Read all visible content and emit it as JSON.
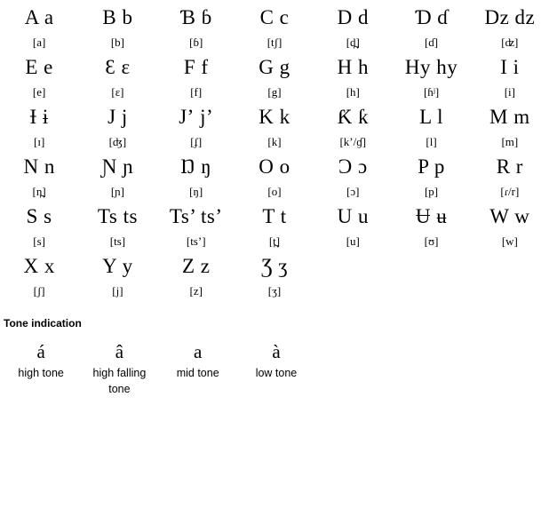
{
  "page": {
    "background_color": "#ffffff",
    "text_color": "#000000"
  },
  "alphabet": {
    "columns": 7,
    "rows": [
      {
        "cells": [
          {
            "letters": "A a",
            "ipa": "[a]"
          },
          {
            "letters": "B b",
            "ipa": "[b]"
          },
          {
            "letters": "Ɓ ɓ",
            "ipa": "[ɓ]"
          },
          {
            "letters": "C c",
            "ipa": "[tʃ]"
          },
          {
            "letters": "D d",
            "ipa": "[d̪]"
          },
          {
            "letters": "Ɗ ɗ",
            "ipa": "[ɗ]"
          },
          {
            "letters": "Dz dz",
            "ipa": "[ʣ]"
          }
        ]
      },
      {
        "cells": [
          {
            "letters": "E e",
            "ipa": "[e]"
          },
          {
            "letters": "Ɛ ɛ",
            "ipa": "[ɛ]"
          },
          {
            "letters": "F f",
            "ipa": "[f]"
          },
          {
            "letters": "G g",
            "ipa": "[g]"
          },
          {
            "letters": "H h",
            "ipa": "[h]"
          },
          {
            "letters": "Hy hy",
            "ipa": "[ɦʲ]"
          },
          {
            "letters": "I i",
            "ipa": "[i]"
          }
        ]
      },
      {
        "cells": [
          {
            "letters": "Ɨ ɨ",
            "ipa": "[ɪ]"
          },
          {
            "letters": "J j",
            "ipa": "[ʤ]"
          },
          {
            "letters": "Jʼ jʼ",
            "ipa": "[ʄ]"
          },
          {
            "letters": "K k",
            "ipa": "[k]"
          },
          {
            "letters": "Ƙ ƙ",
            "ipa": "[k’/ɠ]"
          },
          {
            "letters": "L l",
            "ipa": "[l]"
          },
          {
            "letters": "M m",
            "ipa": "[m]"
          }
        ]
      },
      {
        "cells": [
          {
            "letters": "N n",
            "ipa": "[n̪]"
          },
          {
            "letters": "Ɲ ɲ",
            "ipa": "[ɲ]"
          },
          {
            "letters": "Ŋ ŋ",
            "ipa": "[ŋ]"
          },
          {
            "letters": "O o",
            "ipa": "[o]"
          },
          {
            "letters": "Ɔ ɔ",
            "ipa": "[ɔ]"
          },
          {
            "letters": "P p",
            "ipa": "[p]"
          },
          {
            "letters": "R r",
            "ipa": "[ɾ/r]"
          }
        ]
      },
      {
        "cells": [
          {
            "letters": "S s",
            "ipa": "[s]"
          },
          {
            "letters": "Ts ts",
            "ipa": "[ts]"
          },
          {
            "letters": "Ts’ ts’",
            "ipa": "[ts’]"
          },
          {
            "letters": "T t",
            "ipa": "[t̪]"
          },
          {
            "letters": "U u",
            "ipa": "[u]"
          },
          {
            "letters": "Ʉ ʉ",
            "ipa": "[ʊ]"
          },
          {
            "letters": "W w",
            "ipa": "[w]"
          }
        ]
      },
      {
        "cells": [
          {
            "letters": "X x",
            "ipa": "[ʃ]"
          },
          {
            "letters": "Y y",
            "ipa": "[j]"
          },
          {
            "letters": "Z z",
            "ipa": "[z]"
          },
          {
            "letters": "Ʒ ʒ",
            "ipa": "[ʒ]"
          },
          {
            "letters": "",
            "ipa": ""
          },
          {
            "letters": "",
            "ipa": ""
          },
          {
            "letters": "",
            "ipa": ""
          }
        ]
      }
    ]
  },
  "tone": {
    "heading": "Tone indication",
    "items": [
      {
        "mark": "á",
        "label": "high tone"
      },
      {
        "mark": "â",
        "label": "high falling tone"
      },
      {
        "mark": "a",
        "label": "mid tone"
      },
      {
        "mark": "à",
        "label": "low tone"
      },
      {
        "mark": "",
        "label": ""
      },
      {
        "mark": "",
        "label": ""
      },
      {
        "mark": "",
        "label": ""
      }
    ]
  }
}
